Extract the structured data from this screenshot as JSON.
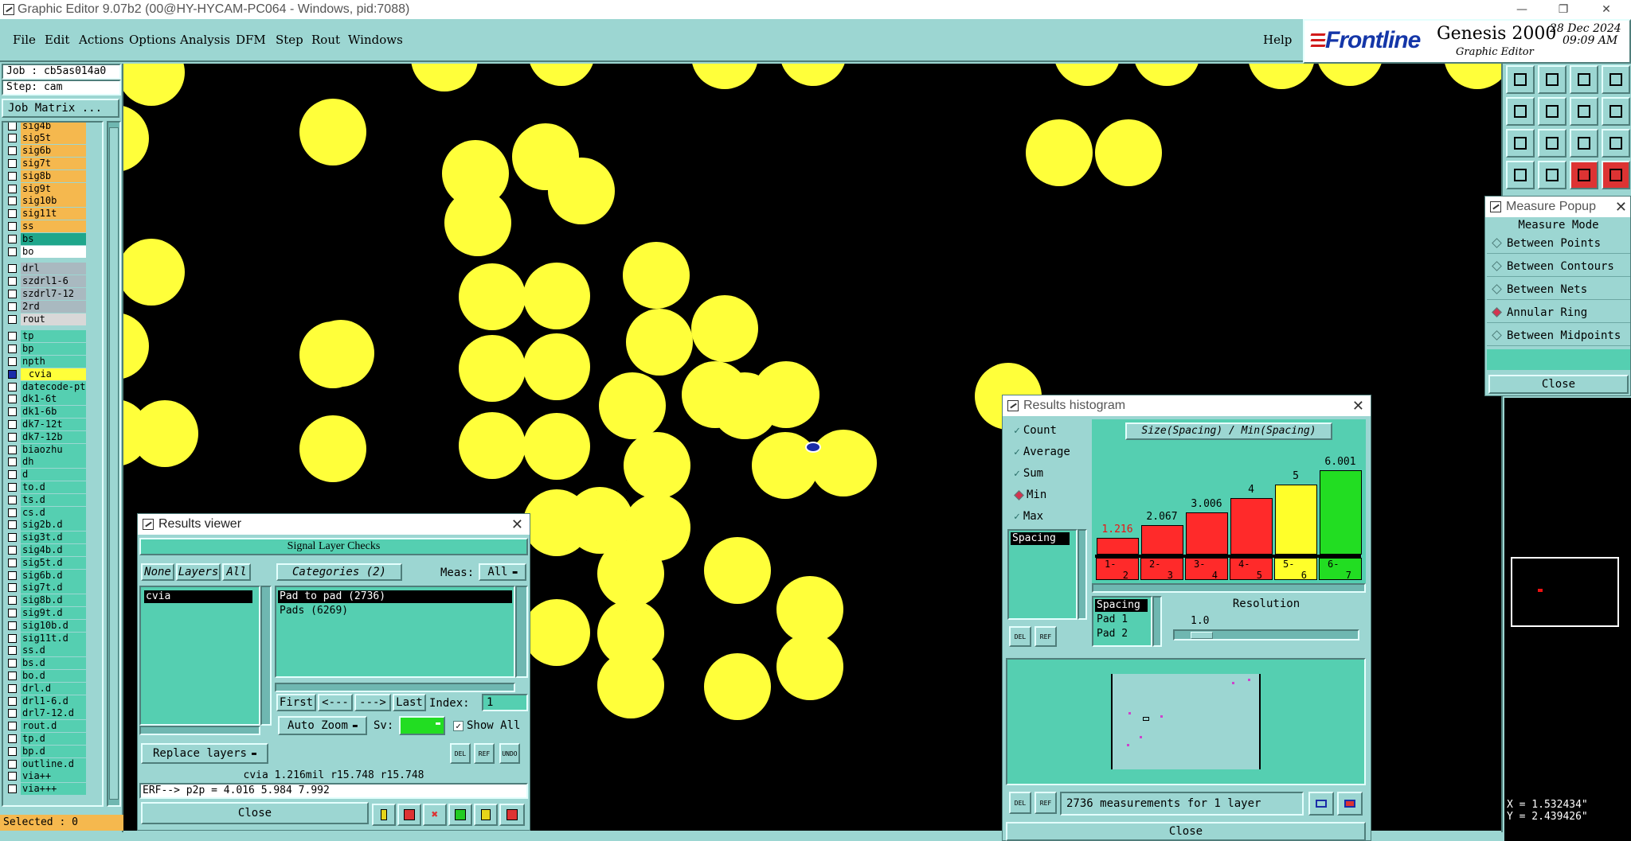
{
  "window": {
    "title": "Graphic Editor 9.07b2 (00@HY-HYCAM-PC064 - Windows, pid:7088)"
  },
  "menu": {
    "items": [
      "File",
      "Edit",
      "Actions",
      "Options",
      "Analysis",
      "DFM",
      "Step",
      "Rout",
      "Windows"
    ],
    "help": "Help"
  },
  "brand": {
    "logo": "Frontline",
    "product": "Genesis 2000",
    "subtitle": "Graphic Editor",
    "date": "28 Dec 2024",
    "time": "09:09 AM"
  },
  "job": {
    "job_label": "Job : cb5as014a0",
    "step_label": "Step: cam",
    "matrix_button": "Job Matrix ..."
  },
  "layers": [
    {
      "name": "sig4b",
      "color": "#f5b84e"
    },
    {
      "name": "sig5t",
      "color": "#f5b84e"
    },
    {
      "name": "sig6b",
      "color": "#f5b84e"
    },
    {
      "name": "sig7t",
      "color": "#f5b84e"
    },
    {
      "name": "sig8b",
      "color": "#f5b84e"
    },
    {
      "name": "sig9t",
      "color": "#f5b84e"
    },
    {
      "name": "sig10b",
      "color": "#f5b84e"
    },
    {
      "name": "sig11t",
      "color": "#f5b84e"
    },
    {
      "name": "ss",
      "color": "#f5b84e"
    },
    {
      "name": "bs",
      "color": "#1fa68b"
    },
    {
      "name": "bo",
      "color": "#ffffff"
    },
    {
      "name": "drl",
      "color": "#a9b9c0"
    },
    {
      "name": "szdrl1-6",
      "color": "#a9b9c0"
    },
    {
      "name": "szdrl7-12",
      "color": "#a9b9c0"
    },
    {
      "name": "2rd",
      "color": "#a9b9c0"
    },
    {
      "name": "rout",
      "color": "#d8d8d8"
    },
    {
      "name": "tp"
    },
    {
      "name": "bp"
    },
    {
      "name": "npth"
    },
    {
      "name": "cvia",
      "selected": true
    },
    {
      "name": "datecode-pt"
    },
    {
      "name": "dk1-6t"
    },
    {
      "name": "dk1-6b"
    },
    {
      "name": "dk7-12t"
    },
    {
      "name": "dk7-12b"
    },
    {
      "name": "biaozhu"
    },
    {
      "name": "dh"
    },
    {
      "name": "d"
    },
    {
      "name": "to.d"
    },
    {
      "name": "ts.d"
    },
    {
      "name": "cs.d"
    },
    {
      "name": "sig2b.d"
    },
    {
      "name": "sig3t.d"
    },
    {
      "name": "sig4b.d"
    },
    {
      "name": "sig5t.d"
    },
    {
      "name": "sig6b.d"
    },
    {
      "name": "sig7t.d"
    },
    {
      "name": "sig8b.d"
    },
    {
      "name": "sig9t.d"
    },
    {
      "name": "sig10b.d"
    },
    {
      "name": "sig11t.d"
    },
    {
      "name": "ss.d"
    },
    {
      "name": "bs.d"
    },
    {
      "name": "bo.d"
    },
    {
      "name": "drl.d"
    },
    {
      "name": "drl1-6.d"
    },
    {
      "name": "drl7-12.d"
    },
    {
      "name": "rout.d"
    },
    {
      "name": "tp.d"
    },
    {
      "name": "bp.d"
    },
    {
      "name": "outline.d"
    },
    {
      "name": "via++"
    },
    {
      "name": "via+++"
    }
  ],
  "status": {
    "selected": "Selected : 0"
  },
  "measure_popup": {
    "title": "Measure Popup",
    "header": "Measure Mode",
    "modes": [
      {
        "label": "Between Points",
        "active": false
      },
      {
        "label": "Between Contours",
        "active": false
      },
      {
        "label": "Between Nets",
        "active": false
      },
      {
        "label": "Annular Ring",
        "active": true
      },
      {
        "label": "Between Midpoints",
        "active": false
      }
    ],
    "close": "Close"
  },
  "coords": {
    "x": "X = 1.532434\"",
    "y": "Y = 2.439426\""
  },
  "results_viewer": {
    "title": "Results viewer",
    "section": "Signal Layer Checks",
    "none": "None",
    "layers": "Layers",
    "all": "All",
    "categories": "Categories (2)",
    "meas_label": "Meas:",
    "meas_value": "All",
    "layer_list": [
      "cvia"
    ],
    "category_list": [
      "Pad to pad (2736)",
      "Pads (6269)"
    ],
    "first": "First",
    "prev": "<---",
    "next": "--->",
    "last": "Last",
    "index_label": "Index:",
    "index_value": "1",
    "auto_zoom": "Auto Zoom",
    "sv_label": "Sv:",
    "show_all": "Show All",
    "replace_layers": "Replace layers",
    "del": "DEL",
    "ref": "REF",
    "undo": "UNDO",
    "info": "cvia 1.216mil  r15.748  r15.748",
    "erf": "ERF--> p2p = 4.016 5.984 7.992",
    "close": "Close"
  },
  "histogram": {
    "title": "Results histogram",
    "modes": [
      {
        "label": "Count",
        "active": false
      },
      {
        "label": "Average",
        "active": false
      },
      {
        "label": "Sum",
        "active": false
      },
      {
        "label": "Min",
        "active": true
      },
      {
        "label": "Max",
        "active": false
      }
    ],
    "list_item": "Spacing",
    "del": "DEL",
    "ref": "REF",
    "list2": [
      "Spacing",
      "Pad 1",
      "Pad 2"
    ],
    "resolution_label": "Resolution",
    "resolution_value": "1.0",
    "summary": "2736 measurements for 1 layer",
    "close": "Close"
  },
  "chart_data": {
    "type": "bar",
    "title": "Size(Spacing) / Min(Spacing)",
    "categories": [
      "1-2",
      "2-3",
      "3-4",
      "4-5",
      "5-6",
      "6-7"
    ],
    "values": [
      1.216,
      2.067,
      3.006,
      4,
      5,
      6.001
    ],
    "value_labels": [
      "1.216",
      "2.067",
      "3.006",
      "4",
      "5",
      "6.001"
    ],
    "colors": [
      "#ff2a2a",
      "#ff2a2a",
      "#ff2a2a",
      "#ff2a2a",
      "#ffff2a",
      "#22dd22"
    ],
    "ylim": [
      0,
      6.001
    ]
  }
}
